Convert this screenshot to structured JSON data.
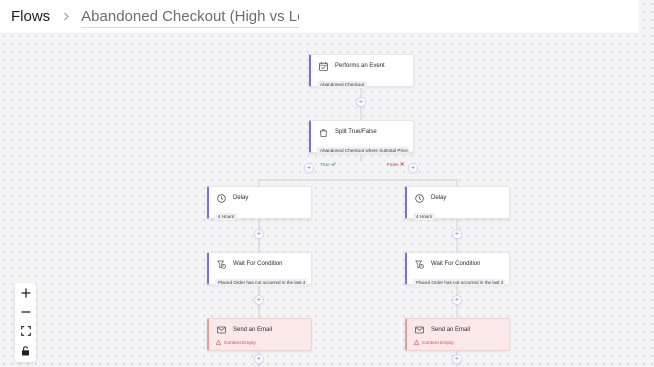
{
  "header": {
    "breadcrumb_root": "Flows",
    "separator_icon": "chevron-right-icon",
    "flow_name_value": "Abandoned Checkout (High vs Low C"
  },
  "colors": {
    "accent": "#7b6cf6",
    "true_branch": "#2ea35a",
    "false_branch": "#d64545",
    "email_node_bg": "#fbe8e8",
    "warning_text": "#d14b4b"
  },
  "nodes": {
    "trigger": {
      "icon": "calendar-event-icon",
      "title": "Performs an Event",
      "detail": "Abandoned Checkout"
    },
    "split": {
      "icon": "split-bag-icon",
      "title": "Split True/False",
      "detail": "Abandoned Checkout where Subtotal Price..."
    },
    "true_delay": {
      "icon": "clock-icon",
      "title": "Delay",
      "detail": "4 Hours"
    },
    "false_delay": {
      "icon": "clock-icon",
      "title": "Delay",
      "detail": "4 Hours"
    },
    "true_wait": {
      "icon": "wait-condition-icon",
      "title": "Wait For Condition",
      "detail": "Placed Order has not occurred in the last 4 ..."
    },
    "false_wait": {
      "icon": "wait-condition-icon",
      "title": "Wait For Condition",
      "detail": "Placed Order has not occurred in the last 4 ..."
    },
    "true_email": {
      "icon": "envelope-icon",
      "title": "Send an Email",
      "warning": "Content Empty"
    },
    "false_email": {
      "icon": "envelope-icon",
      "title": "Send an Email",
      "warning": "Content Empty"
    }
  },
  "branches": {
    "true_label": "True",
    "true_icon": "checkmark-icon",
    "false_label": "False",
    "false_icon": "x-icon"
  },
  "add_step_label": "+",
  "zoom_controls": [
    {
      "name": "zoom-in",
      "icon": "plus-icon"
    },
    {
      "name": "zoom-out",
      "icon": "minus-icon"
    },
    {
      "name": "fit-view",
      "icon": "fit-screen-icon"
    },
    {
      "name": "lock",
      "icon": "lock-icon"
    }
  ]
}
